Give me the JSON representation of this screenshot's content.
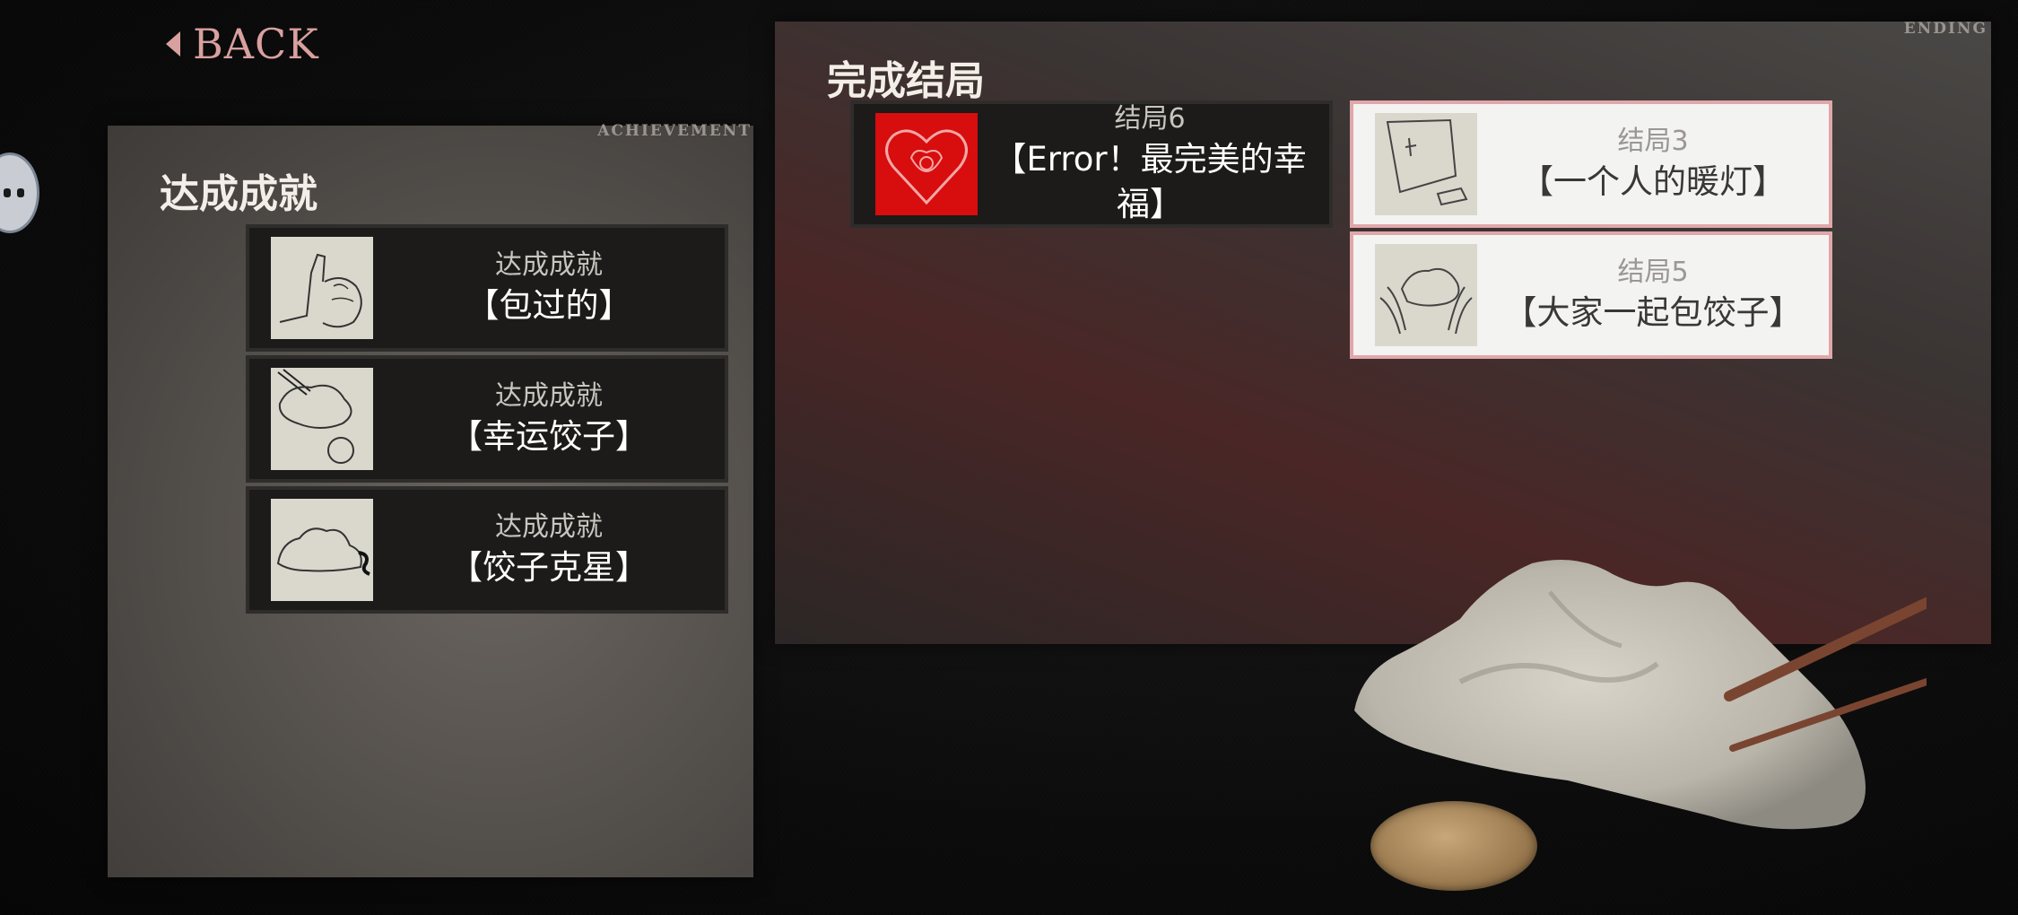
{
  "nav": {
    "back_label": "BACK"
  },
  "achievement": {
    "tag": "ACHIEVEMENT",
    "title": "达成成就",
    "items": [
      {
        "sub": "达成成就",
        "name": "【包过的】",
        "icon": "thumbs-up-dumpling-icon"
      },
      {
        "sub": "达成成就",
        "name": "【幸运饺子】",
        "icon": "chopsticks-dumpling-coin-icon"
      },
      {
        "sub": "达成成就",
        "name": "【饺子克星】",
        "icon": "dumpling-icon"
      }
    ]
  },
  "ending": {
    "tag": "ENDING",
    "title": "完成结局",
    "items": [
      {
        "sub": "结局6",
        "name": "【Error！最完美的幸福】",
        "icon": "heart-womb-icon",
        "style": "dark"
      },
      {
        "sub": "结局3",
        "name": "【一个人的暖灯】",
        "icon": "lantern-icon",
        "style": "light"
      },
      {
        "sub": "结局5",
        "name": "【大家一起包饺子】",
        "icon": "hands-dumpling-icon",
        "style": "light"
      }
    ]
  },
  "colors": {
    "accent_pink": "#d9a0a0",
    "card_dark": "#1c1b1a",
    "card_light": "#f3f3f2",
    "card_light_border": "#e0a7ab",
    "ending_red_thumb": "#d80d0d"
  }
}
